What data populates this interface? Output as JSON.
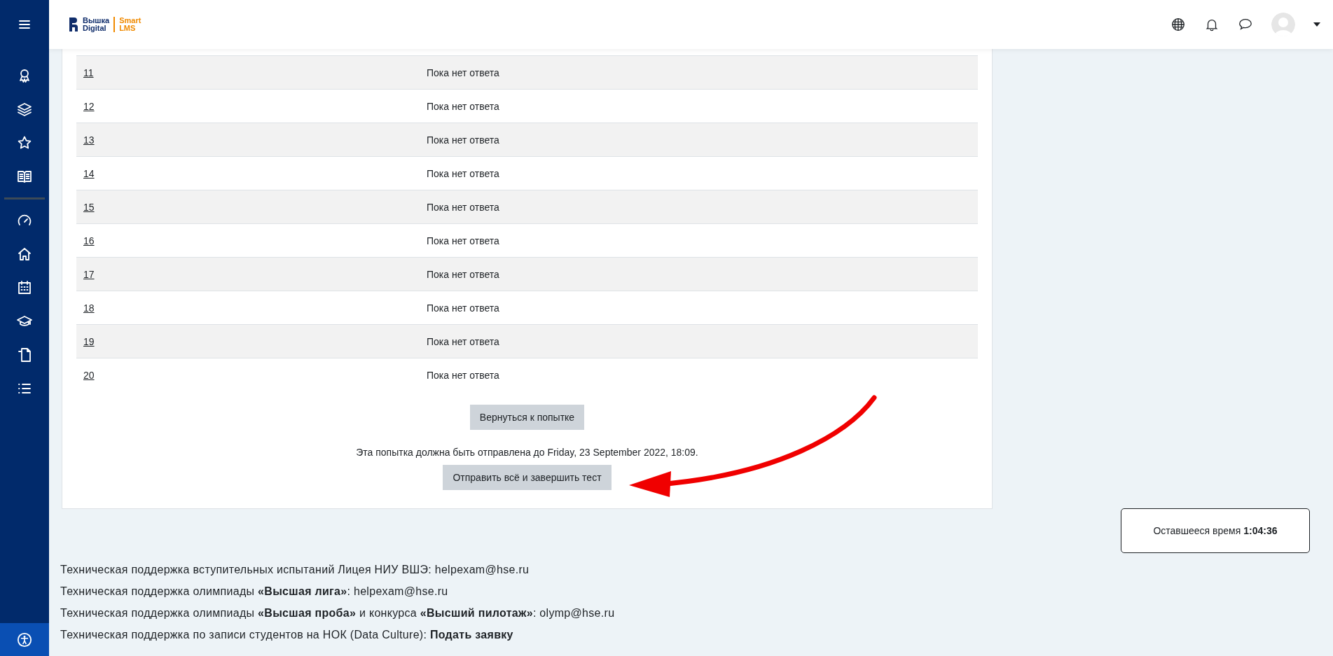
{
  "header": {
    "logo": {
      "line_1": "Вышка",
      "line_2": "Digital",
      "product_1": "Smart",
      "product_2": "LMS"
    }
  },
  "table": {
    "rows": [
      {
        "number": "11",
        "status": "Пока нет ответа"
      },
      {
        "number": "12",
        "status": "Пока нет ответа"
      },
      {
        "number": "13",
        "status": "Пока нет ответа"
      },
      {
        "number": "14",
        "status": "Пока нет ответа"
      },
      {
        "number": "15",
        "status": "Пока нет ответа"
      },
      {
        "number": "16",
        "status": "Пока нет ответа"
      },
      {
        "number": "17",
        "status": "Пока нет ответа"
      },
      {
        "number": "18",
        "status": "Пока нет ответа"
      },
      {
        "number": "19",
        "status": "Пока нет ответа"
      },
      {
        "number": "20",
        "status": "Пока нет ответа"
      }
    ]
  },
  "return_button": "Вернуться к попытке",
  "due_text": "Эта попытка должна быть отправлена до Friday, 23 September 2022, 18:09.",
  "submit_button": "Отправить всё и завершить тест",
  "timer": {
    "label": "Оставшееся время",
    "value": "1:04:36"
  },
  "footer": {
    "lines": [
      "Техническая поддержка вступительных испытаний Лицея НИУ ВШЭ: helpexam@hse.ru",
      "Техническая поддержка олимпиады **«Высшая лига»**: helpexam@hse.ru",
      "Техническая поддержка олимпиады **«Высшая проба»** и конкурса **«Высший пилотаж»**: olymp@hse.ru"
    ],
    "last_line": {
      "text": "Техническая поддержка по записи студентов на НОК (Data Culture):",
      "link": "Подать заявку"
    }
  }
}
